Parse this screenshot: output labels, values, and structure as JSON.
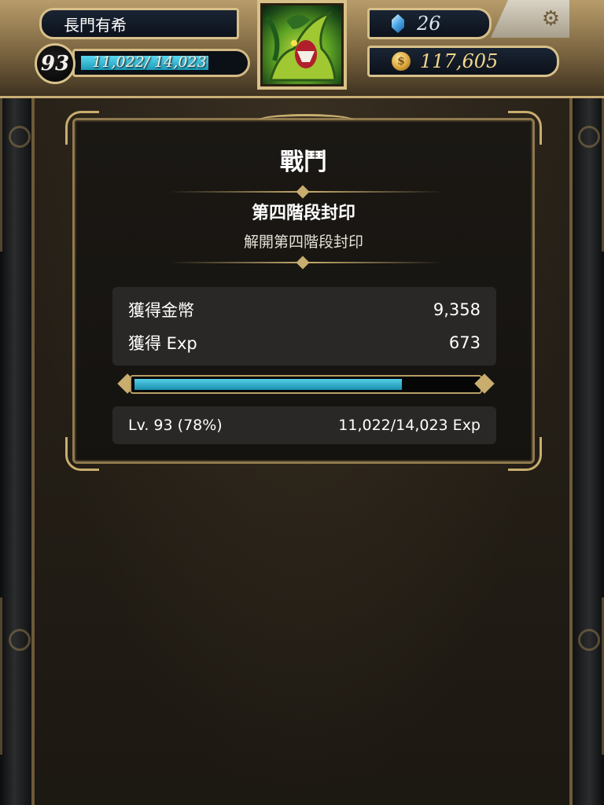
{
  "player": {
    "name": "長門有希",
    "level": "93",
    "exp_display": "11,022/ 14,023",
    "exp_fraction": 0.786
  },
  "currency": {
    "gems": "26",
    "gold": "117,605",
    "gem_icon": "crystal-gem-icon",
    "gold_icon": "gold-coin-icon"
  },
  "portrait": {
    "icon": "leader-card-portrait"
  },
  "settings": {
    "icon": "gear-icon"
  },
  "result": {
    "title": "戰鬥",
    "stage_name": "第四階段封印",
    "stage_subtitle": "解開第四階段封印",
    "rewards": [
      {
        "label": "獲得金幣",
        "value": "9,358"
      },
      {
        "label": "獲得 Exp",
        "value": "673"
      }
    ],
    "level_label": "Lv. 93 (78%)",
    "exp_total": "11,022/14,023 Exp",
    "progress_fraction": 0.78
  },
  "colors": {
    "accent_gold": "#c8ad6f",
    "exp_bar": "#2aa8c8",
    "panel_bg": "#1b1814"
  }
}
